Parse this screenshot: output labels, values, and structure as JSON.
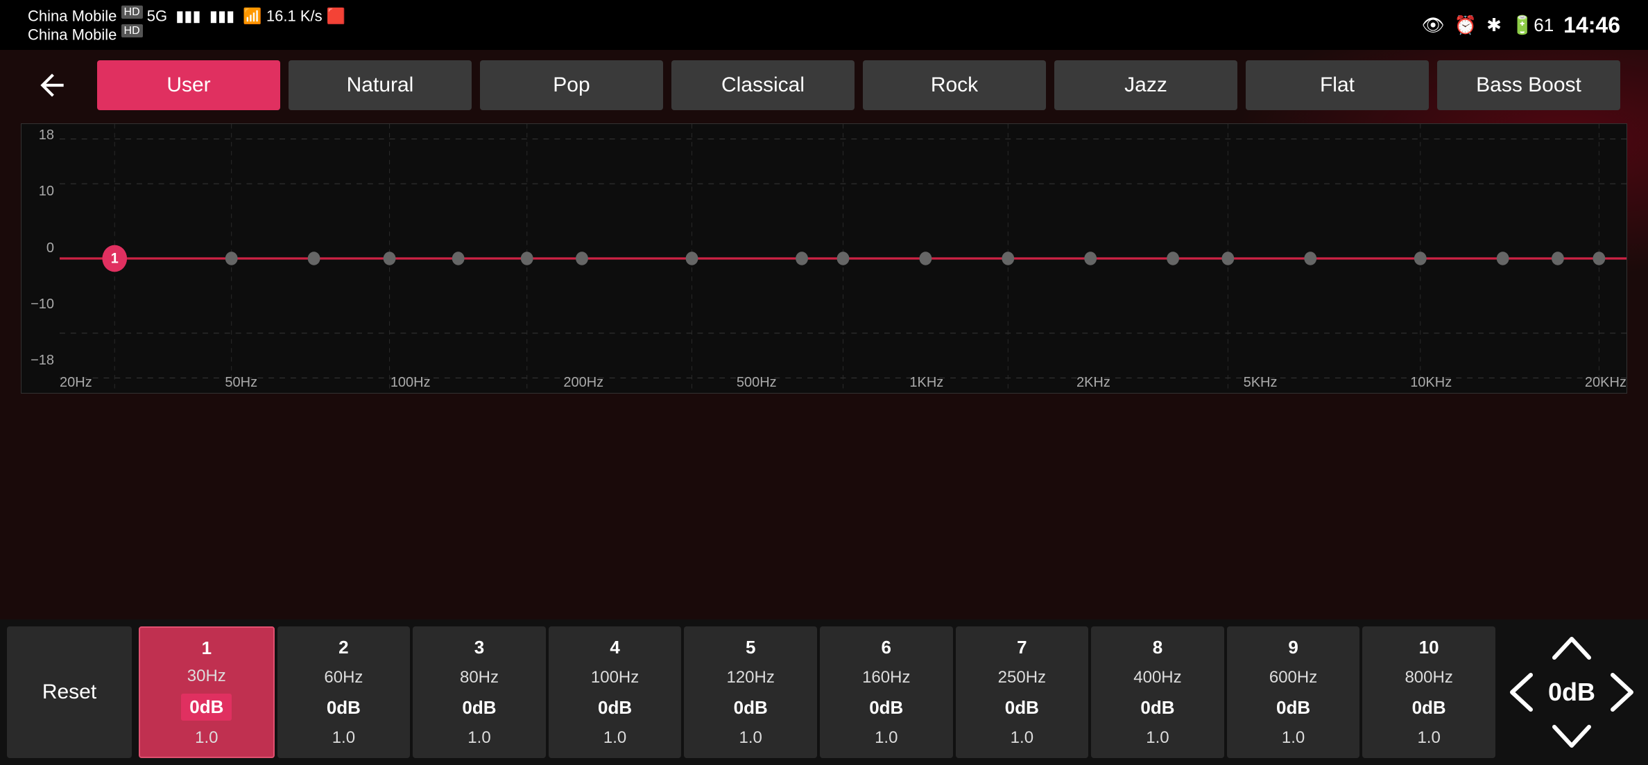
{
  "statusBar": {
    "carrier1": "China Mobile",
    "carrier2": "China Mobile",
    "network": "5G",
    "signal": "HD",
    "speed": "16.1 K/s",
    "time": "14:46",
    "battery": "61"
  },
  "backButton": "←",
  "presets": [
    {
      "id": "user",
      "label": "User",
      "active": true
    },
    {
      "id": "natural",
      "label": "Natural",
      "active": false
    },
    {
      "id": "pop",
      "label": "Pop",
      "active": false
    },
    {
      "id": "classical",
      "label": "Classical",
      "active": false
    },
    {
      "id": "rock",
      "label": "Rock",
      "active": false
    },
    {
      "id": "jazz",
      "label": "Jazz",
      "active": false
    },
    {
      "id": "flat",
      "label": "Flat",
      "active": false
    },
    {
      "id": "bassboost",
      "label": "Bass Boost",
      "active": false
    }
  ],
  "chart": {
    "yLabels": [
      "18",
      "10",
      "0",
      "-10",
      "-18"
    ],
    "xLabels": [
      "20Hz",
      "50Hz",
      "100Hz",
      "200Hz",
      "500Hz",
      "1KHz",
      "2KHz",
      "5KHz",
      "10KHz",
      "20KHz"
    ]
  },
  "bands": [
    {
      "num": "1",
      "freq": "30Hz",
      "db": "0dB",
      "q": "1.0",
      "active": true
    },
    {
      "num": "2",
      "freq": "60Hz",
      "db": "0dB",
      "q": "1.0",
      "active": false
    },
    {
      "num": "3",
      "freq": "80Hz",
      "db": "0dB",
      "q": "1.0",
      "active": false
    },
    {
      "num": "4",
      "freq": "100Hz",
      "db": "0dB",
      "q": "1.0",
      "active": false
    },
    {
      "num": "5",
      "freq": "120Hz",
      "db": "0dB",
      "q": "1.0",
      "active": false
    },
    {
      "num": "6",
      "freq": "160Hz",
      "db": "0dB",
      "q": "1.0",
      "active": false
    },
    {
      "num": "7",
      "freq": "250Hz",
      "db": "0dB",
      "q": "1.0",
      "active": false
    },
    {
      "num": "8",
      "freq": "400Hz",
      "db": "0dB",
      "q": "1.0",
      "active": false
    },
    {
      "num": "9",
      "freq": "600Hz",
      "db": "0dB",
      "q": "1.0",
      "active": false
    },
    {
      "num": "10",
      "freq": "800Hz",
      "db": "0dB",
      "q": "1.0",
      "active": false
    }
  ],
  "resetLabel": "Reset",
  "currentDb": "0dB",
  "colors": {
    "activeTab": "#e03060",
    "activeBand": "#c03050",
    "chartBg": "#0d0d0d",
    "equalizerLine": "#cc2244",
    "dotColor": "#888"
  }
}
